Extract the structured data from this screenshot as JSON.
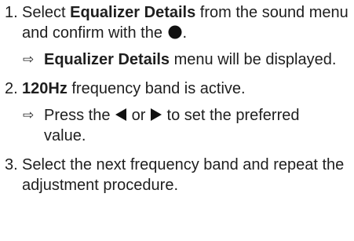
{
  "steps": [
    {
      "number": "1.",
      "text_before": "Select ",
      "bold": "Equalizer Details",
      "text_after": " from the sound menu and confirm with the",
      "text_end": ".",
      "icon": "filled-circle-button-icon",
      "result": {
        "bold": "Equalizer Details",
        "text": " menu will be displayed."
      }
    },
    {
      "number": "2.",
      "bold": "120Hz",
      "text": " frequency band is active.",
      "result": {
        "text_before": "Press the ",
        "icon_left": "left-triangle-icon",
        "or": " or ",
        "icon_right": "right-triangle-icon",
        "text_after": " to set the preferred value."
      }
    },
    {
      "number": "3.",
      "text": "Select the next frequency band and repeat the adjustment procedure."
    }
  ],
  "result_arrow": "⇨",
  "icons": {
    "result_arrow": "right-outline-arrow-icon"
  }
}
